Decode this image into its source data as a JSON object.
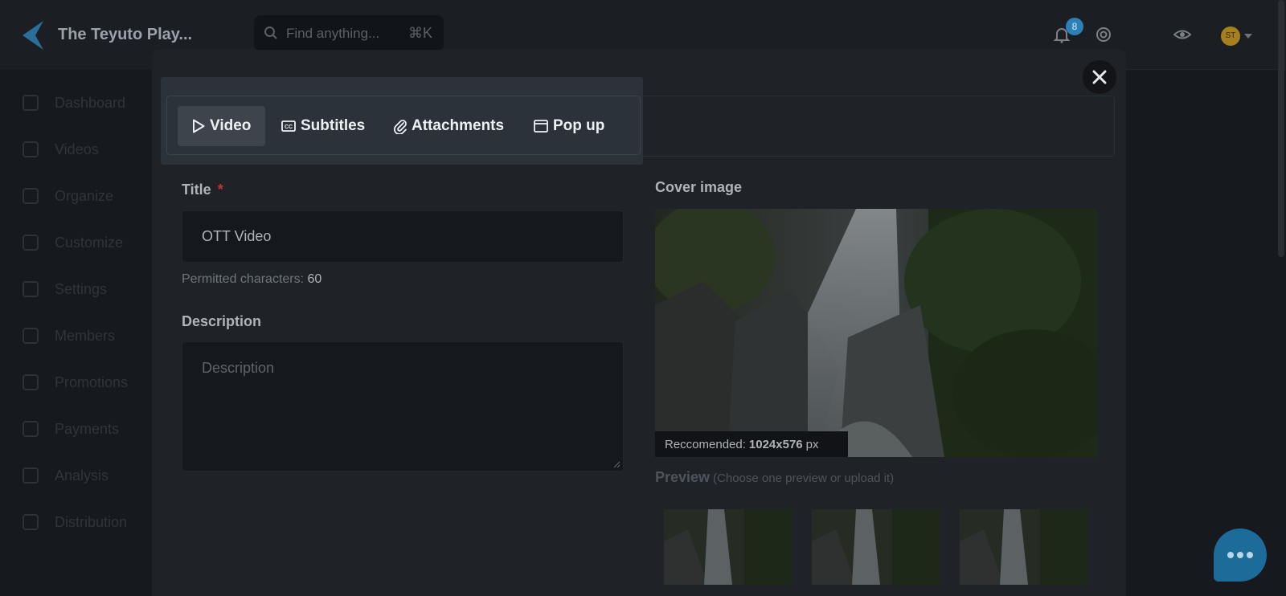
{
  "app": {
    "title": "The Teyuto Play..."
  },
  "search": {
    "placeholder": "Find anything...",
    "shortcut": "⌘K"
  },
  "header": {
    "notification_count": "8",
    "avatar_initials": "ST"
  },
  "sidebar": {
    "items": [
      {
        "label": "Dashboard",
        "icon": "home-icon"
      },
      {
        "label": "Videos",
        "icon": "video-icon"
      },
      {
        "label": "Organize",
        "icon": "organize-icon"
      },
      {
        "label": "Customize",
        "icon": "brush-icon"
      },
      {
        "label": "Settings",
        "icon": "gear-icon"
      },
      {
        "label": "Members",
        "icon": "members-icon"
      },
      {
        "label": "Promotions",
        "icon": "gift-icon"
      },
      {
        "label": "Payments",
        "icon": "card-icon"
      },
      {
        "label": "Analysis",
        "icon": "chart-icon"
      },
      {
        "label": "Distribution",
        "icon": "distribution-icon"
      }
    ]
  },
  "modal": {
    "tabs": [
      {
        "label": "Video",
        "icon": "play-icon",
        "active": true
      },
      {
        "label": "Subtitles",
        "icon": "cc-icon",
        "active": false
      },
      {
        "label": "Attachments",
        "icon": "paperclip-icon",
        "active": false
      },
      {
        "label": "Pop up",
        "icon": "window-icon",
        "active": false
      }
    ],
    "title_field": {
      "label": "Title",
      "required_mark": "*",
      "value": "OTT Video",
      "helper_text": "Permitted characters:",
      "helper_value": "60"
    },
    "description_field": {
      "label": "Description",
      "placeholder": "Description"
    },
    "cover": {
      "label": "Cover image",
      "recommended_prefix": "Reccomended:",
      "recommended_size": "1024x576",
      "recommended_unit": "px"
    },
    "preview": {
      "label": "Preview",
      "hint": "(Choose one preview or upload it)"
    }
  },
  "colors": {
    "accent": "#2d7fb8",
    "required": "#c0392b",
    "chat": "#1d6b99"
  }
}
